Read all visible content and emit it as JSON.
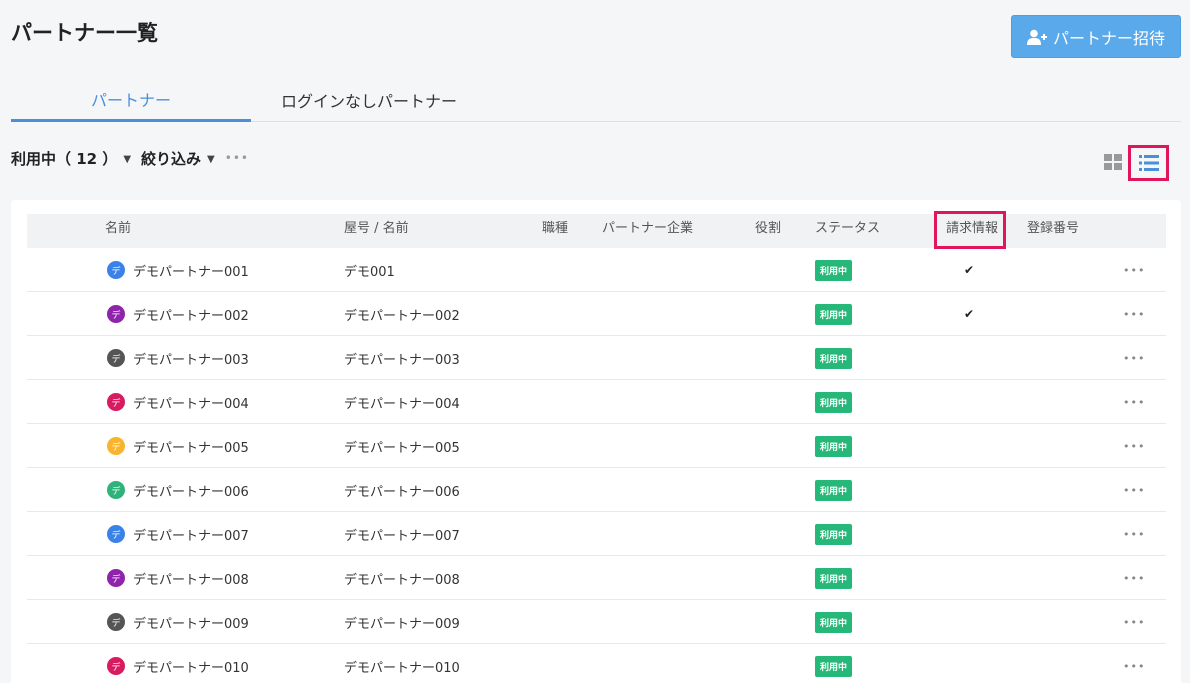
{
  "page": {
    "title": "パートナー一覧",
    "invite_label": "パートナー招待"
  },
  "tabs": [
    {
      "label": "パートナー",
      "active": true
    },
    {
      "label": "ログインなしパートナー",
      "active": false
    }
  ],
  "filters": {
    "status_label": "利用中（ 12 ）",
    "filter_label": "絞り込み",
    "more": "•••"
  },
  "view": {
    "grid_icon": "grid-view-icon",
    "list_icon": "list-view-icon"
  },
  "table": {
    "headers": [
      "名前",
      "屋号 / 名前",
      "職種",
      "パートナー企業",
      "役割",
      "ステータス",
      "請求情報",
      "登録番号"
    ],
    "rows": [
      {
        "name": "デモパートナー001",
        "trade_name": "デモ001",
        "status": "利用中",
        "billing": "✔",
        "avatar": "デ",
        "color": "#3b82e8"
      },
      {
        "name": "デモパートナー002",
        "trade_name": "デモパートナー002",
        "status": "利用中",
        "billing": "✔",
        "avatar": "デ",
        "color": "#8e24aa"
      },
      {
        "name": "デモパートナー003",
        "trade_name": "デモパートナー003",
        "status": "利用中",
        "billing": "",
        "avatar": "デ",
        "color": "#555555"
      },
      {
        "name": "デモパートナー004",
        "trade_name": "デモパートナー004",
        "status": "利用中",
        "billing": "",
        "avatar": "デ",
        "color": "#d81b60"
      },
      {
        "name": "デモパートナー005",
        "trade_name": "デモパートナー005",
        "status": "利用中",
        "billing": "",
        "avatar": "デ",
        "color": "#f9b42d"
      },
      {
        "name": "デモパートナー006",
        "trade_name": "デモパートナー006",
        "status": "利用中",
        "billing": "",
        "avatar": "デ",
        "color": "#2fb37a"
      },
      {
        "name": "デモパートナー007",
        "trade_name": "デモパートナー007",
        "status": "利用中",
        "billing": "",
        "avatar": "デ",
        "color": "#3b82e8"
      },
      {
        "name": "デモパートナー008",
        "trade_name": "デモパートナー008",
        "status": "利用中",
        "billing": "",
        "avatar": "デ",
        "color": "#8e24aa"
      },
      {
        "name": "デモパートナー009",
        "trade_name": "デモパートナー009",
        "status": "利用中",
        "billing": "",
        "avatar": "デ",
        "color": "#555555"
      },
      {
        "name": "デモパートナー010",
        "trade_name": "デモパートナー010",
        "status": "利用中",
        "billing": "",
        "avatar": "デ",
        "color": "#d81b60"
      }
    ],
    "row_more": "•••"
  },
  "colors": {
    "accent": "#4a90d9",
    "status_green": "#26b878",
    "highlight": "#e0155b"
  }
}
